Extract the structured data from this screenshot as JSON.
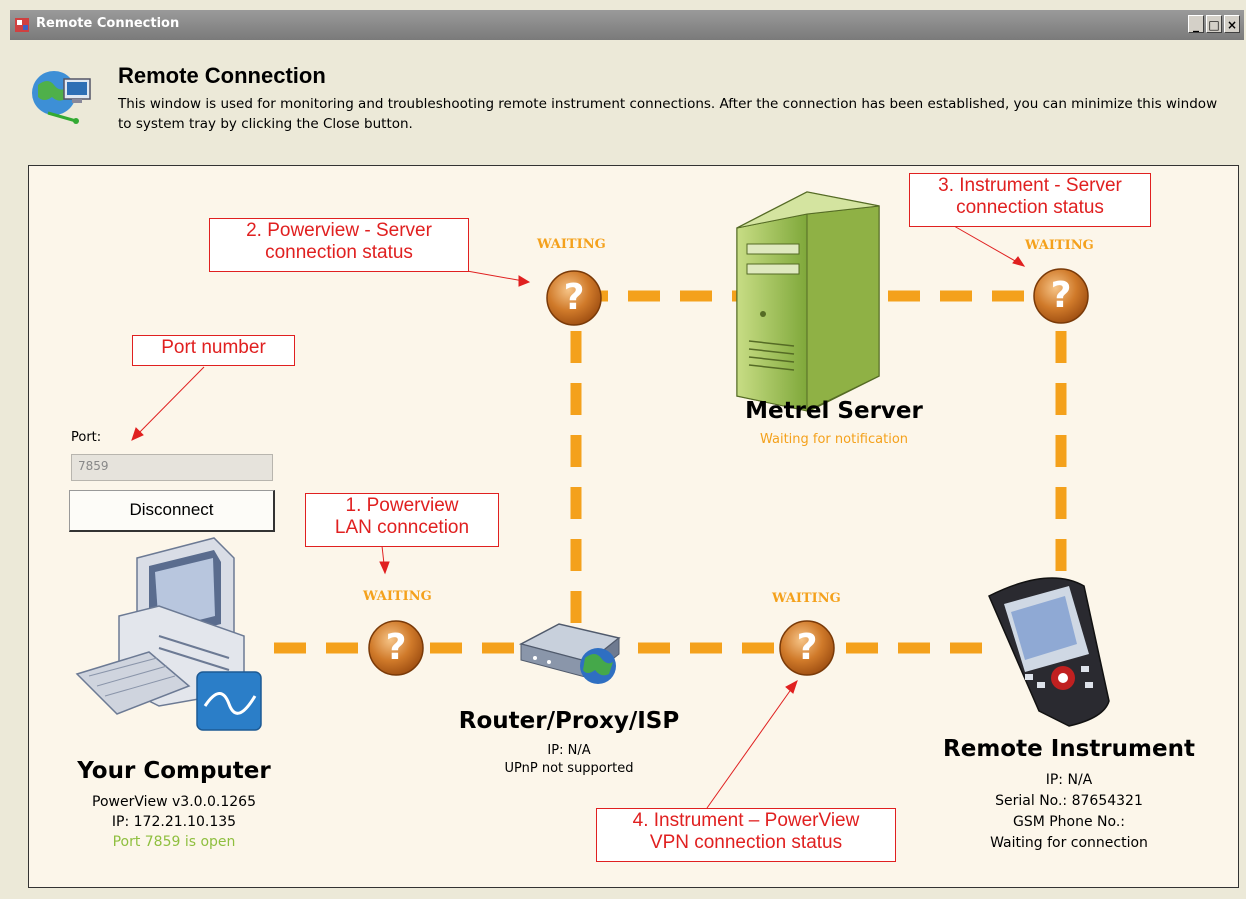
{
  "window": {
    "title": "Remote Connection",
    "controls": {
      "minimize": "_",
      "maximize": "□",
      "close": "×"
    }
  },
  "header": {
    "title": "Remote Connection",
    "description": "This window is used for monitoring and troubleshooting remote instrument connections. After the connection has been established, you can minimize this window to system tray by clicking the Close button."
  },
  "port": {
    "label": "Port:",
    "value": "7859",
    "button": "Disconnect"
  },
  "status": {
    "powerview_server": "WAITING",
    "instrument_server": "WAITING",
    "powerview_lan": "WAITING",
    "instrument_powerview": "WAITING"
  },
  "nodes": {
    "computer": {
      "title": "Your Computer",
      "version": "PowerView v3.0.0.1265",
      "ip": "IP: 172.21.10.135",
      "port_status": "Port 7859 is open"
    },
    "router": {
      "title": "Router/Proxy/ISP",
      "ip": "IP: N/A",
      "upnp": "UPnP not supported"
    },
    "server": {
      "title": "Metrel Server",
      "status": "Waiting for notification"
    },
    "instrument": {
      "title": "Remote Instrument",
      "ip": "IP: N/A",
      "serial": "Serial No.: 87654321",
      "gsm": "GSM Phone No.:",
      "connection": "Waiting for connection"
    }
  },
  "callouts": {
    "powerview_server": [
      "2. Powerview - Server",
      "connection status"
    ],
    "instrument_server": [
      "3. Instrument - Server",
      "connection status"
    ],
    "port_number": [
      "Port number"
    ],
    "powerview_lan": [
      "1. Powerview",
      "LAN conncetion"
    ],
    "instrument_powerview": [
      "4. Instrument – PowerView",
      "VPN connection status"
    ]
  },
  "colors": {
    "accent_orange": "#f4a11c",
    "callout_red": "#e02020",
    "ok_green": "#8fbf3f",
    "panel_bg": "#fcf6ea",
    "window_bg": "#ece9d8"
  }
}
